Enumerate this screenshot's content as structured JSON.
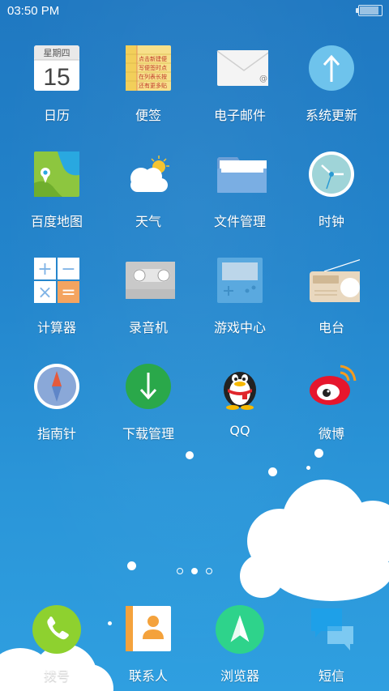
{
  "status_bar": {
    "time": "03:50 PM",
    "battery_level": 0.9
  },
  "apps": {
    "calendar": {
      "label": "日历",
      "weekday": "星期四",
      "day": "15"
    },
    "notes": {
      "label": "便签",
      "lines": [
        "点击新建便",
        "写便签时点",
        "在列表长按",
        "还有更多贴"
      ]
    },
    "email": {
      "label": "电子邮件",
      "at": "@"
    },
    "system_update": {
      "label": "系统更新"
    },
    "baidu_map": {
      "label": "百度地图"
    },
    "weather": {
      "label": "天气"
    },
    "file_manager": {
      "label": "文件管理"
    },
    "clock": {
      "label": "时钟"
    },
    "calculator": {
      "label": "计算器",
      "symbols": [
        "+",
        "−",
        "×",
        "="
      ]
    },
    "recorder": {
      "label": "录音机"
    },
    "game_center": {
      "label": "游戏中心"
    },
    "radio": {
      "label": "电台"
    },
    "compass": {
      "label": "指南针"
    },
    "download_manager": {
      "label": "下载管理"
    },
    "qq": {
      "label": "QQ"
    },
    "weibo": {
      "label": "微博"
    }
  },
  "dock": {
    "phone": {
      "label": "拨号"
    },
    "contacts": {
      "label": "联系人"
    },
    "browser": {
      "label": "浏览器"
    },
    "sms": {
      "label": "短信"
    }
  },
  "pager": {
    "pages": 3,
    "current": 2
  },
  "colors": {
    "wallpaper_top": "#1f78c1",
    "wallpaper_bottom": "#2f9fe0",
    "phone_green": "#8ed12f",
    "download_green": "#2aa84a",
    "browser_green": "#2ed38b",
    "sms_blue": "#1ea0e8",
    "system_update_blue": "#6ec3ec",
    "weibo_red": "#e6162d"
  }
}
